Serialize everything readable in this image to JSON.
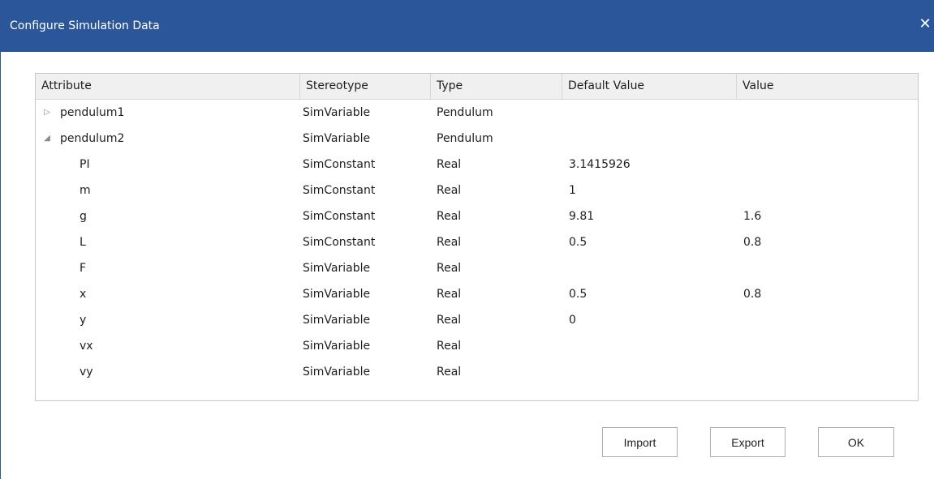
{
  "window": {
    "title": "Configure Simulation Data",
    "close_glyph": "✕"
  },
  "grid": {
    "columns": [
      "Attribute",
      "Stereotype",
      "Type",
      "Default Value",
      "Value"
    ],
    "rows": [
      {
        "attribute": "pendulum1",
        "stereotype": "SimVariable",
        "type": "Pendulum",
        "default": "",
        "value": "",
        "expander": "collapsed",
        "twisty": "▷"
      },
      {
        "attribute": "pendulum2",
        "stereotype": "SimVariable",
        "type": "Pendulum",
        "default": "",
        "value": "",
        "expander": "expanded",
        "twisty": "◢"
      },
      {
        "attribute": "PI",
        "stereotype": "SimConstant",
        "type": "Real",
        "default": "3.1415926",
        "value": ""
      },
      {
        "attribute": "m",
        "stereotype": "SimConstant",
        "type": "Real",
        "default": "1",
        "value": ""
      },
      {
        "attribute": "g",
        "stereotype": "SimConstant",
        "type": "Real",
        "default": "9.81",
        "value": "1.6"
      },
      {
        "attribute": "L",
        "stereotype": "SimConstant",
        "type": "Real",
        "default": "0.5",
        "value": "0.8"
      },
      {
        "attribute": "F",
        "stereotype": "SimVariable",
        "type": "Real",
        "default": "",
        "value": ""
      },
      {
        "attribute": "x",
        "stereotype": "SimVariable",
        "type": "Real",
        "default": "0.5",
        "value": "0.8"
      },
      {
        "attribute": "y",
        "stereotype": "SimVariable",
        "type": "Real",
        "default": "0",
        "value": ""
      },
      {
        "attribute": "vx",
        "stereotype": "SimVariable",
        "type": "Real",
        "default": "",
        "value": ""
      },
      {
        "attribute": "vy",
        "stereotype": "SimVariable",
        "type": "Real",
        "default": "",
        "value": ""
      }
    ]
  },
  "buttons": {
    "import": "Import",
    "export": "Export",
    "ok": "OK"
  },
  "colors": {
    "titlebar": "#2b579a",
    "header_bg": "#f0f0f0",
    "grid_border": "#c8c8c8"
  }
}
